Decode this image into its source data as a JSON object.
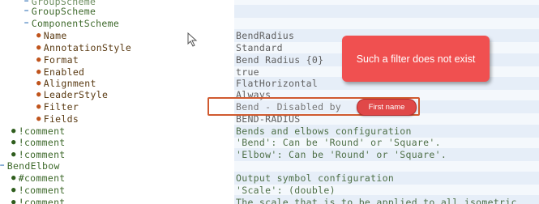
{
  "tree": [
    {
      "mark": "minus",
      "text": "GroupScheme",
      "kind": "node"
    },
    {
      "mark": "minus",
      "text": "GroupScheme",
      "kind": "node"
    },
    {
      "mark": "minus",
      "text": "ComponentScheme",
      "kind": "node"
    },
    {
      "mark": "bullet",
      "text": "Name",
      "kind": "attr"
    },
    {
      "mark": "bullet",
      "text": "AnnotationStyle",
      "kind": "attr"
    },
    {
      "mark": "bullet",
      "text": "Format",
      "kind": "attr"
    },
    {
      "mark": "bullet",
      "text": "Enabled",
      "kind": "attr"
    },
    {
      "mark": "bullet",
      "text": "Alignment",
      "kind": "attr"
    },
    {
      "mark": "bullet",
      "text": "LeaderStyle",
      "kind": "attr"
    },
    {
      "mark": "bullet",
      "text": "Filter",
      "kind": "attr"
    },
    {
      "mark": "bullet",
      "text": "Fields",
      "kind": "attr"
    },
    {
      "mark": "dot",
      "text": "comment",
      "kind": "comment"
    },
    {
      "mark": "dot",
      "text": "comment",
      "kind": "comment"
    },
    {
      "mark": "dot",
      "text": "comment",
      "kind": "comment"
    },
    {
      "mark": "minus",
      "text": "BendElbow",
      "kind": "node"
    },
    {
      "mark": "dot",
      "text": "comment",
      "kind": "comment"
    },
    {
      "mark": "dot",
      "text": "comment",
      "kind": "comment"
    },
    {
      "mark": "dot",
      "text": "comment",
      "kind": "comment"
    }
  ],
  "values": [
    "",
    "",
    "",
    "BendRadius",
    "Standard",
    "Bend Radius {0}",
    "true",
    "FlatHorizontal",
    "Always",
    "Bend - Disabled by",
    "BEND-RADIUS",
    "Bends and elbows configuration",
    "'Bend': Can be 'Round' or 'Square'.",
    "'Elbow': Can be 'Round' or 'Square'.",
    "",
    "Output symbol configuration",
    "'Scale': (double)",
    "The scale that is to be applied to all isometric"
  ],
  "callout": {
    "text": "Such a filter does not exist"
  },
  "pill": {
    "text": "First name"
  },
  "colors": {
    "highlight": "#d05a2f",
    "callout": "#f05050",
    "pill": "#e04848"
  }
}
